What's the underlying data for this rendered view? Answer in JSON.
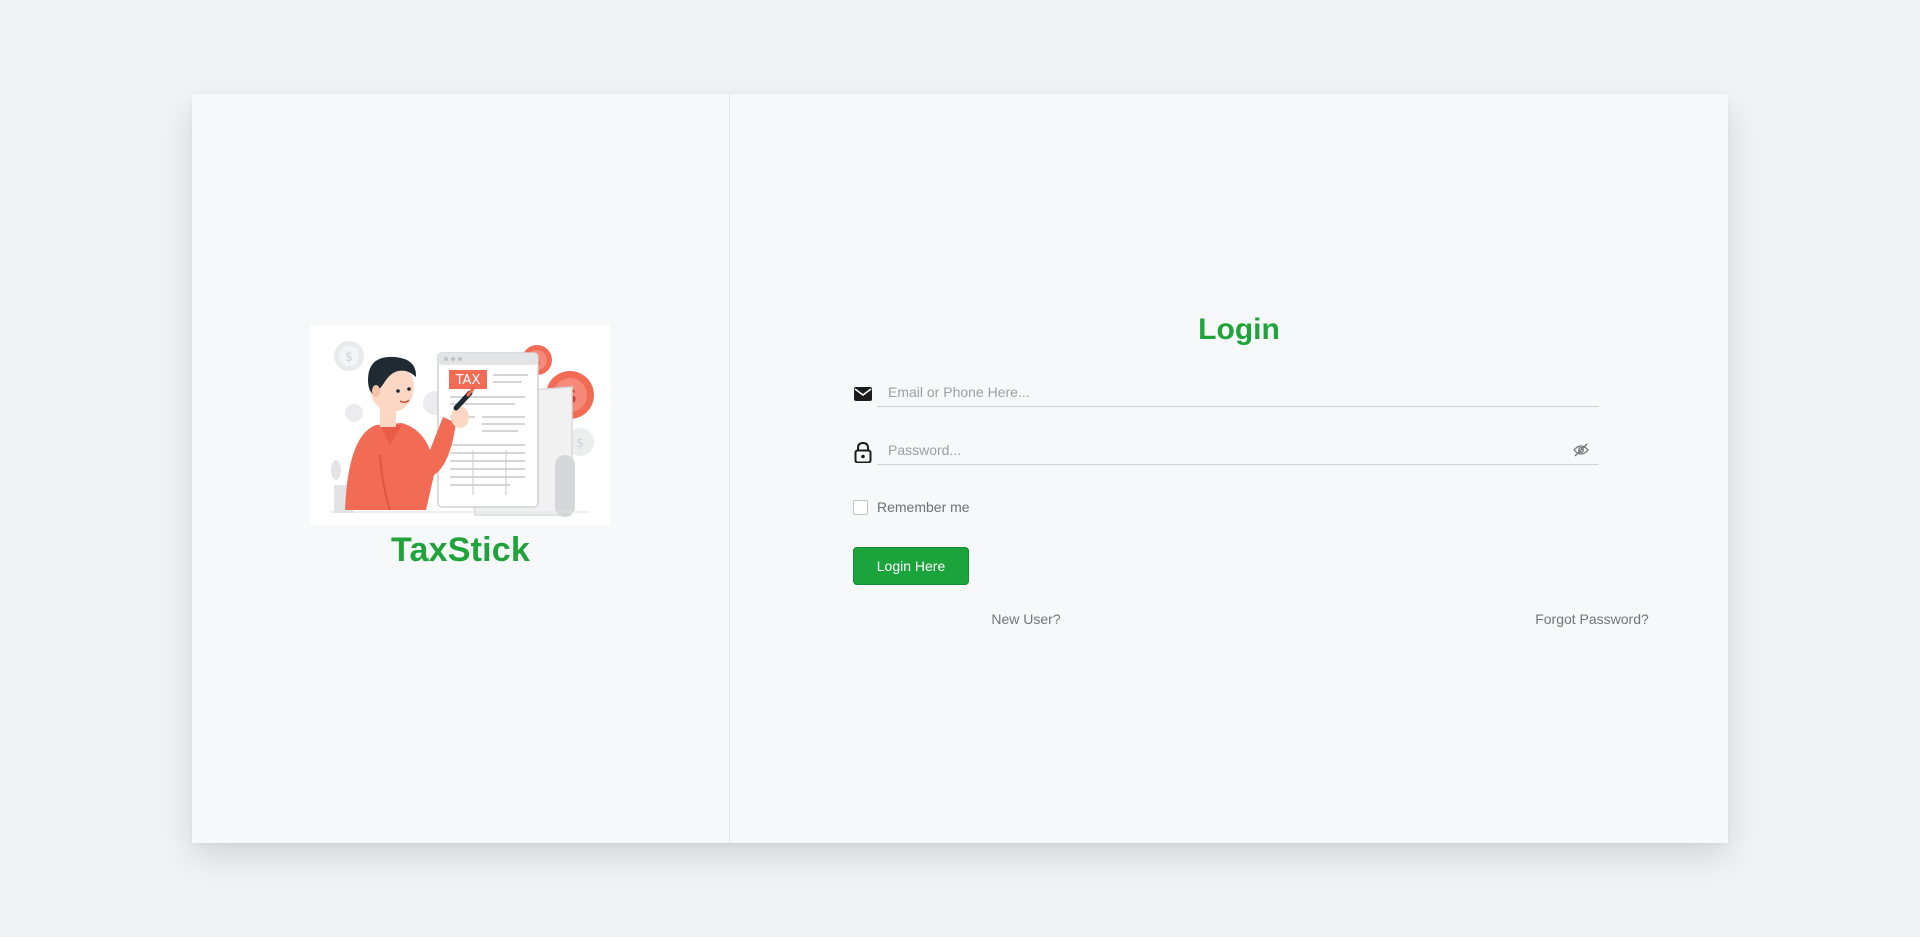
{
  "brand": {
    "name": "TaxStick"
  },
  "illustration": {
    "label": "TAX",
    "icon": "tax-document-illustration"
  },
  "form": {
    "title": "Login",
    "email": {
      "placeholder": "Email or Phone Here...",
      "value": "",
      "icon": "envelope-icon"
    },
    "password": {
      "placeholder": "Password...",
      "value": "",
      "icon": "lock-icon",
      "toggle_icon": "eye-slash-icon"
    },
    "remember": {
      "label": "Remember me",
      "checked": false
    },
    "submit_label": "Login Here",
    "new_user_link": "New User?",
    "forgot_link": "Forgot Password?"
  },
  "colors": {
    "accent": "#1fa33a",
    "button": "#1ba43b",
    "illustration_accent": "#f26b55",
    "background": "#f2f3f5",
    "card": "#f7f8fa"
  }
}
